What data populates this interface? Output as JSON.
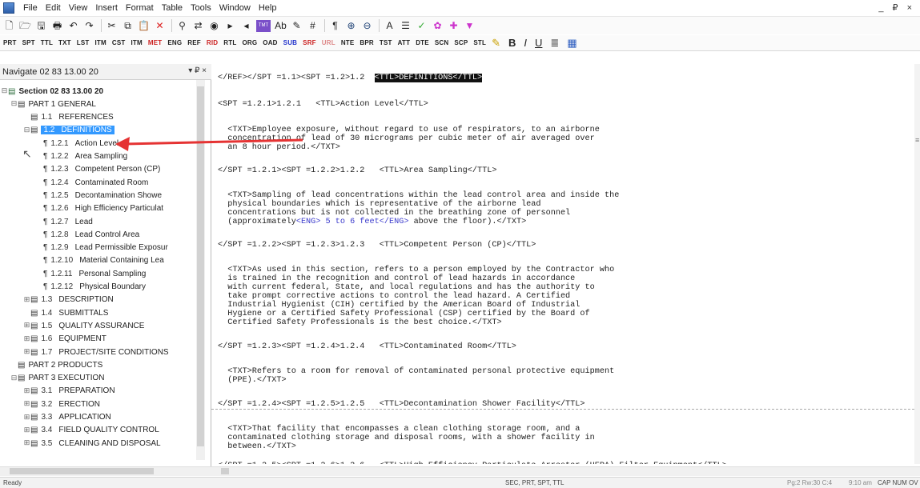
{
  "menubar": {
    "items": [
      "File",
      "Edit",
      "View",
      "Insert",
      "Format",
      "Table",
      "Tools",
      "Window",
      "Help"
    ],
    "window_controls": "_ ₽ ×"
  },
  "toolbar": {
    "icons": [
      "new-doc-icon",
      "open-folder-icon",
      "save-icon",
      "print-icon",
      "undo-icon",
      "redo-icon",
      "cut-icon",
      "copy-icon",
      "paste-icon",
      "delete-icon",
      "find-icon",
      "replace-icon",
      "binoculars-icon",
      "find-next-icon",
      "find-prev-icon",
      "tmt-icon",
      "spell-icon",
      "grammar-icon",
      "word-count-icon",
      "pilcrow-icon",
      "zoom-in-icon",
      "zoom-out-icon",
      "font-size-icon",
      "list-icon",
      "check-icon",
      "tag-icon",
      "add-icon",
      "funnel-icon"
    ],
    "tmt_label": "TMT",
    "pilcrow": "¶"
  },
  "tag_toolbar": {
    "tags": [
      "PRT",
      "SPT",
      "TTL",
      "TXT",
      "LST",
      "ITM",
      "CST",
      "ITM",
      "MET",
      "ENG",
      "REF",
      "RID",
      "RTL",
      "ORG",
      "OAD",
      "SUB",
      "SRF",
      "URL",
      "NTE",
      "BPR",
      "TST",
      "ATT",
      "DTE",
      "SCN",
      "SCP",
      "STL"
    ],
    "tag_colors": {
      "MET": "#cc2222",
      "RID": "#cc2222",
      "SUB": "#2233cc",
      "SRF": "#cc2222",
      "URL": "#dd8888"
    },
    "format_buttons": [
      "B",
      "I",
      "U"
    ]
  },
  "nav": {
    "title": "Navigate 02 83 13.00 20",
    "pin": "▾ ₽ ×",
    "items": [
      {
        "num": "",
        "label": "Section 02 83 13.00 20",
        "level": 0,
        "expander": "⊟",
        "bold": true
      },
      {
        "num": "",
        "label": "PART 1  GENERAL",
        "level": 1,
        "expander": "⊟"
      },
      {
        "num": "1.1",
        "label": "REFERENCES",
        "level": 2,
        "expander": ""
      },
      {
        "num": "1.2",
        "label": "DEFINITIONS",
        "level": 2,
        "expander": "⊟",
        "selected": true
      },
      {
        "num": "1.2.1",
        "label": "Action Level",
        "level": 3
      },
      {
        "num": "1.2.2",
        "label": "Area Sampling",
        "level": 3
      },
      {
        "num": "1.2.3",
        "label": "Competent Person (CP)",
        "level": 3
      },
      {
        "num": "1.2.4",
        "label": "Contaminated Room",
        "level": 3
      },
      {
        "num": "1.2.5",
        "label": "Decontamination Showe",
        "level": 3
      },
      {
        "num": "1.2.6",
        "label": "High Efficiency Particulat",
        "level": 3
      },
      {
        "num": "1.2.7",
        "label": "Lead",
        "level": 3
      },
      {
        "num": "1.2.8",
        "label": "Lead Control Area",
        "level": 3
      },
      {
        "num": "1.2.9",
        "label": "Lead Permissible Exposur",
        "level": 3
      },
      {
        "num": "1.2.10",
        "label": "Material Containing Lea",
        "level": 3
      },
      {
        "num": "1.2.11",
        "label": "Personal Sampling",
        "level": 3
      },
      {
        "num": "1.2.12",
        "label": "Physical Boundary",
        "level": 3
      },
      {
        "num": "1.3",
        "label": "DESCRIPTION",
        "level": 2,
        "expander": "⊞"
      },
      {
        "num": "1.4",
        "label": "SUBMITTALS",
        "level": 2,
        "expander": ""
      },
      {
        "num": "1.5",
        "label": "QUALITY ASSURANCE",
        "level": 2,
        "expander": "⊞"
      },
      {
        "num": "1.6",
        "label": "EQUIPMENT",
        "level": 2,
        "expander": "⊞"
      },
      {
        "num": "1.7",
        "label": "PROJECT/SITE CONDITIONS",
        "level": 2,
        "expander": "⊞"
      },
      {
        "num": "",
        "label": "PART 2  PRODUCTS",
        "level": 1,
        "expander": ""
      },
      {
        "num": "",
        "label": "PART 3  EXECUTION",
        "level": 1,
        "expander": "⊟"
      },
      {
        "num": "3.1",
        "label": "PREPARATION",
        "level": 2,
        "expander": "⊞"
      },
      {
        "num": "3.2",
        "label": "ERECTION",
        "level": 2,
        "expander": "⊞"
      },
      {
        "num": "3.3",
        "label": "APPLICATION",
        "level": 2,
        "expander": "⊞"
      },
      {
        "num": "3.4",
        "label": "FIELD QUALITY CONTROL",
        "level": 2,
        "expander": "⊞"
      },
      {
        "num": "3.5",
        "label": "CLEANING AND DISPOSAL",
        "level": 2,
        "expander": "⊞"
      }
    ],
    "scroll_label": "III"
  },
  "editor": {
    "lines": [
      {
        "t": "</REF></SPT =1.1><SPT =1.2>1.2  ",
        "hl": "<TTL>DEFINITIONS</TTL>"
      },
      {
        "t": "<SPT =1.2.1>1.2.1   <TTL>Action Level</TTL>"
      },
      {
        "t": "  <TXT>Employee exposure, without regard to use of respirators, to an airborne"
      },
      {
        "t": "  concentration of lead of 30 micrograms per cubic meter of air averaged over"
      },
      {
        "t": "  an 8 hour period.</TXT>"
      },
      {
        "t": "</SPT =1.2.1><SPT =1.2.2>1.2.2   <TTL>Area Sampling</TTL>"
      },
      {
        "t": "  <TXT>Sampling of lead concentrations within the lead control area and inside the"
      },
      {
        "t": "  physical boundaries which is representative of the airborne lead"
      },
      {
        "t": "  concentrations but is not collected in the breathing zone of personnel"
      },
      {
        "t": "  (approximately",
        "blue": "<ENG> 5 to 6 feet</ENG>",
        "tail": " above the floor).</TXT>"
      },
      {
        "t": "</SPT =1.2.2><SPT =1.2.3>1.2.3   <TTL>Competent Person (CP)</TTL>"
      },
      {
        "t": "  <TXT>As used in this section, refers to a person employed by the Contractor who"
      },
      {
        "t": "  is trained in the recognition and control of lead hazards in accordance"
      },
      {
        "t": "  with current federal, State, and local regulations and has the authority to"
      },
      {
        "t": "  take prompt corrective actions to control the lead hazard. A Certified"
      },
      {
        "t": "  Industrial Hygienist (CIH) certified by the American Board of Industrial"
      },
      {
        "t": "  Hygiene or a Certified Safety Professional (CSP) certified by the Board of"
      },
      {
        "t": "  Certified Safety Professionals is the best choice.</TXT>"
      },
      {
        "t": "</SPT =1.2.3><SPT =1.2.4>1.2.4   <TTL>Contaminated Room</TTL>"
      },
      {
        "t": "  <TXT>Refers to a room for removal of contaminated personal protective equipment"
      },
      {
        "t": "  (PPE).</TXT>"
      },
      {
        "t": "</SPT =1.2.4><SPT =1.2.5>1.2.5   <TTL>Decontamination Shower Facility</TTL>"
      },
      {
        "t": "  <TXT>That facility that encompasses a clean clothing storage room, and a"
      },
      {
        "t": "  contaminated clothing storage and disposal rooms, with a shower facility in"
      },
      {
        "t": "  between.</TXT>"
      },
      {
        "t": "</SPT =1.2.5><SPT =1.2.6>1.2.6   <TTL>High Efficiency Particulate Arrestor (HEPA) Filter Equipment</TTL>"
      }
    ],
    "scroll_label": "III"
  },
  "status": {
    "ready": "Ready",
    "tags": "SEC, PRT, SPT, TTL",
    "position": "Pg:2 Rw:30 C:4",
    "time": "9:10 am",
    "caps": "CAP  NUM  OV"
  },
  "colors": {
    "selection": "#3399ff",
    "highlight": "#111111",
    "arrow": "#e53333",
    "eng_tag": "#3b3bcc"
  }
}
